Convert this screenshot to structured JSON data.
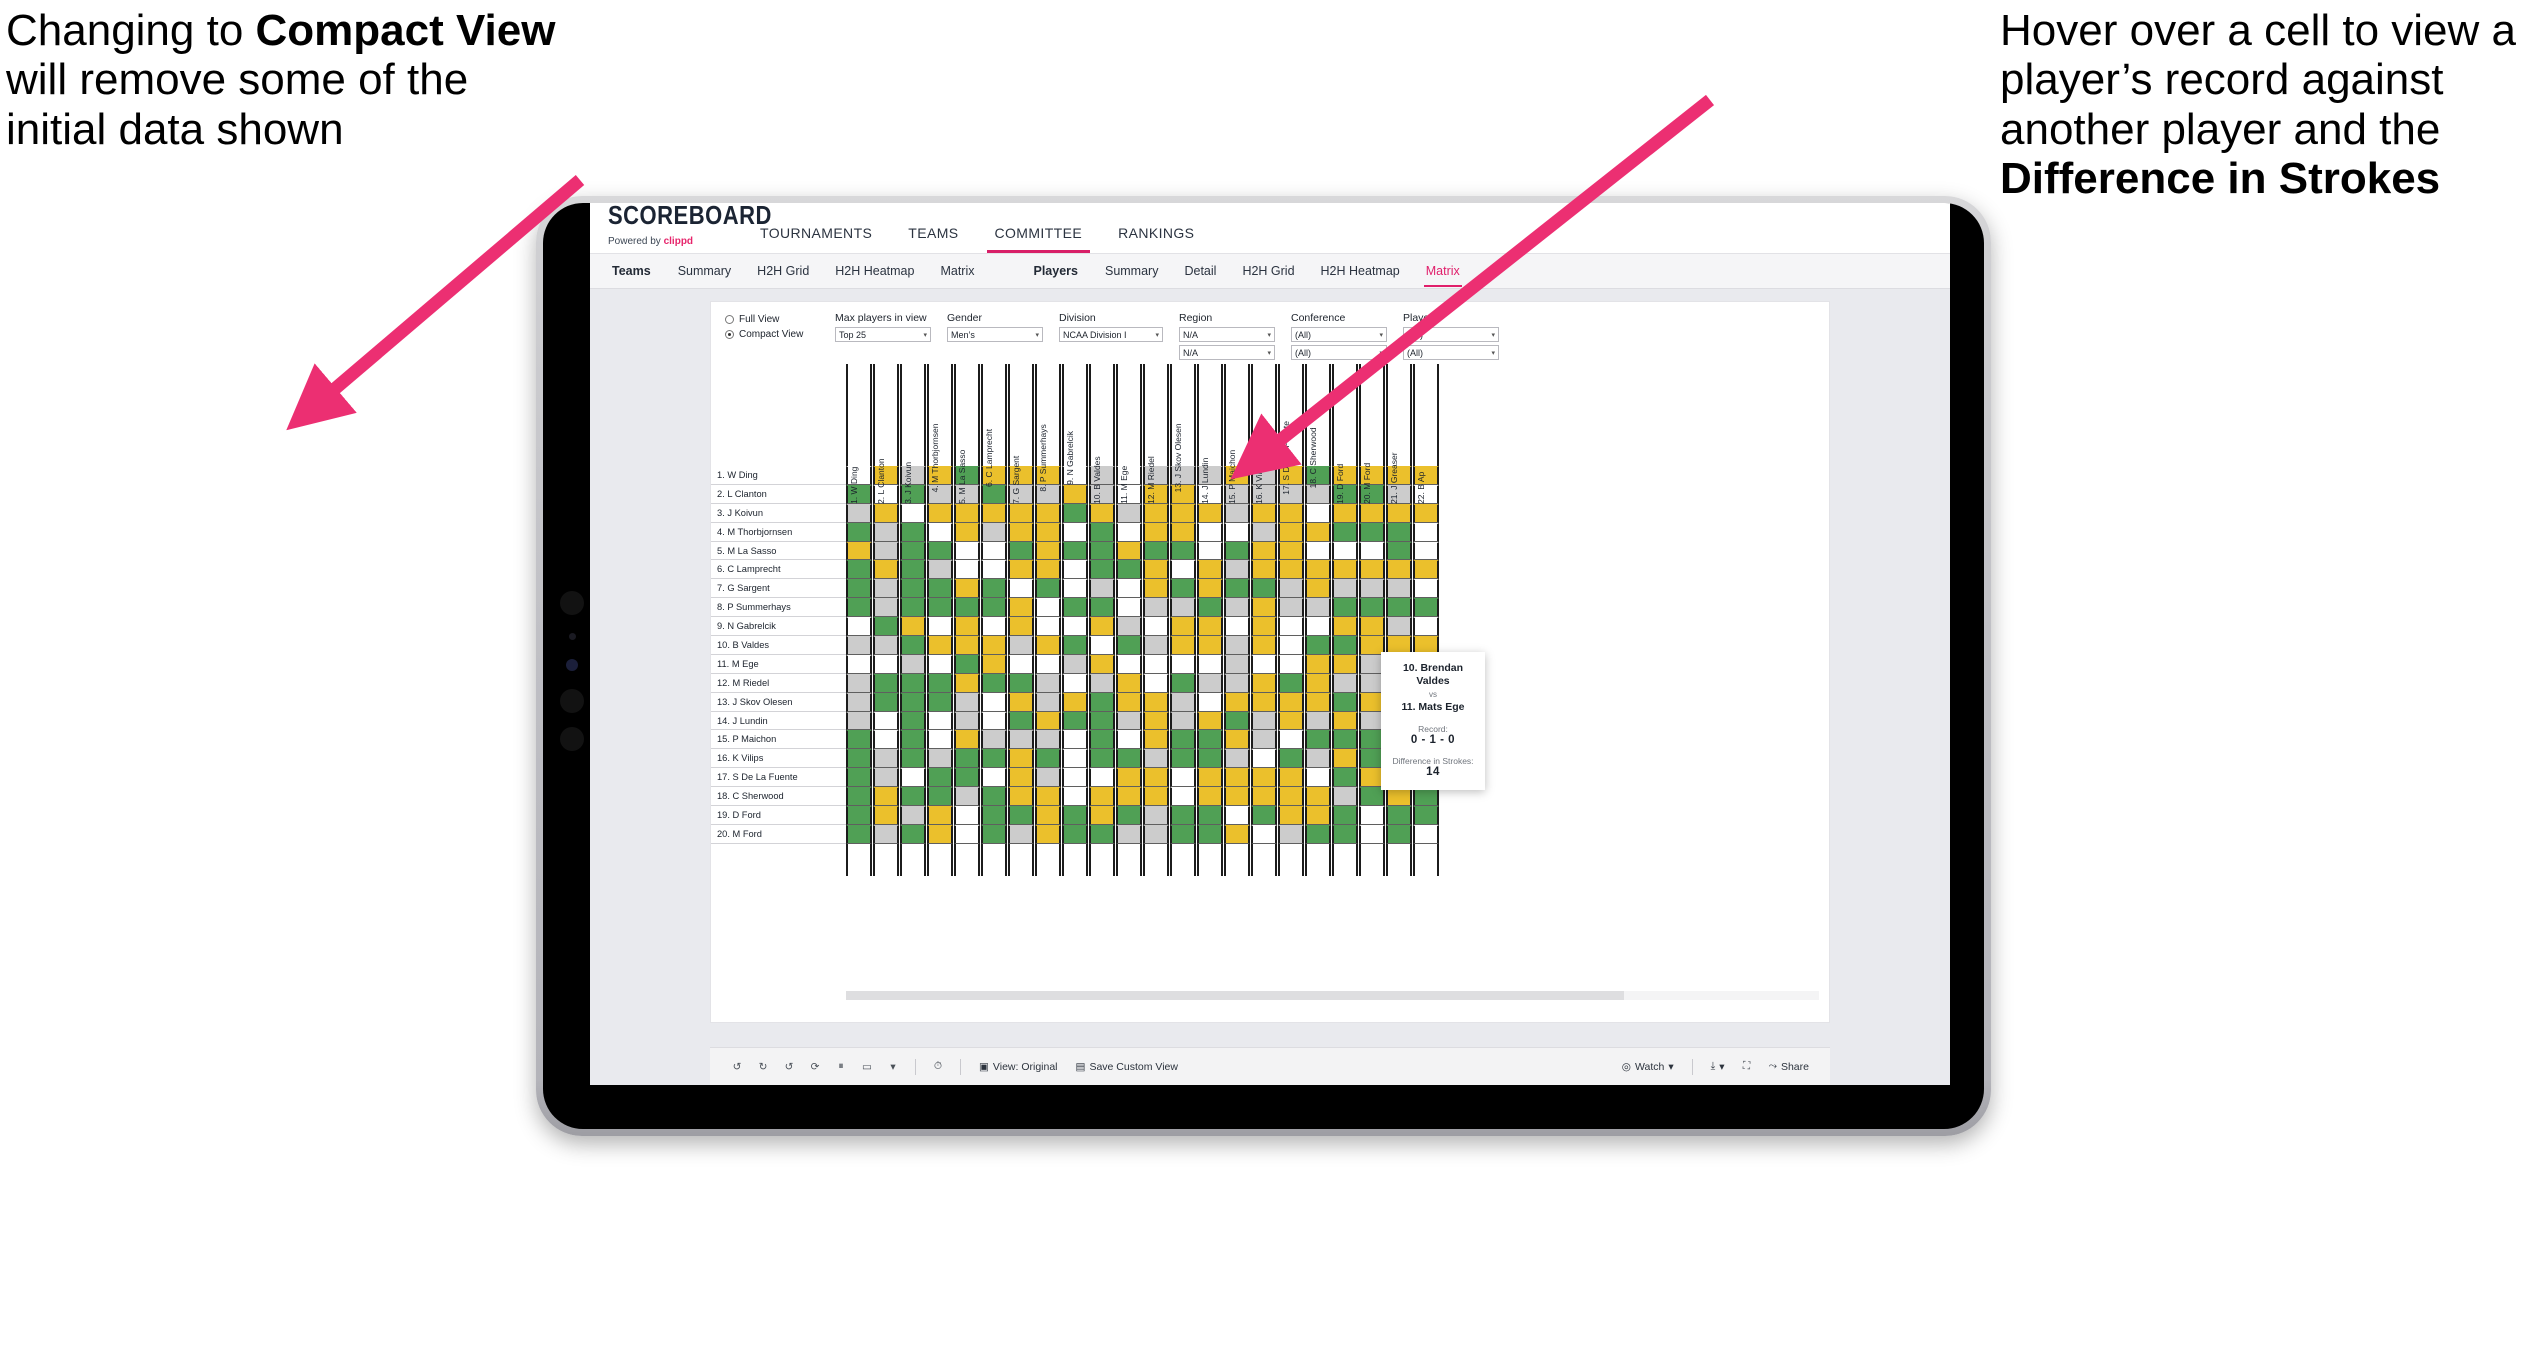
{
  "annotations": {
    "left": {
      "pre": "Changing to ",
      "bold": "Compact View",
      "post": " will remove some of the initial data shown"
    },
    "right": {
      "pre": "Hover over a cell to view a player’s record against another player and the ",
      "bold": "Difference in Strokes",
      "post": ""
    }
  },
  "brand": {
    "name": "SCOREBOARD",
    "powered_pre": "Powered by ",
    "powered_brand": "clippd"
  },
  "topnav": {
    "tabs": [
      "TOURNAMENTS",
      "TEAMS",
      "COMMITTEE",
      "RANKINGS"
    ],
    "active": "COMMITTEE"
  },
  "subnav": {
    "teams_label": "Teams",
    "teams_items": [
      "Summary",
      "H2H Grid",
      "H2H Heatmap",
      "Matrix"
    ],
    "players_label": "Players",
    "players_items": [
      "Summary",
      "Detail",
      "H2H Grid",
      "H2H Heatmap",
      "Matrix"
    ],
    "active": "Matrix"
  },
  "filters": {
    "view_mode": {
      "full_label": "Full View",
      "compact_label": "Compact View",
      "selected": "Compact View"
    },
    "fields": [
      {
        "label": "Max players in view",
        "value": "Top 25",
        "value2": ""
      },
      {
        "label": "Gender",
        "value": "Men’s",
        "value2": ""
      },
      {
        "label": "Division",
        "value": "NCAA Division I",
        "value2": ""
      },
      {
        "label": "Region",
        "value": "N/A",
        "value2": "N/A"
      },
      {
        "label": "Conference",
        "value": "(All)",
        "value2": "(All)"
      },
      {
        "label": "Players",
        "value": "(All)",
        "value2": "(All)"
      }
    ]
  },
  "matrix": {
    "columns": [
      "1. W Ding",
      "2. L Clanton",
      "3. J Koivun",
      "4. M Thorbjornsen",
      "5. M La Sasso",
      "6. C Lamprecht",
      "7. G Sargent",
      "8. P Summerhays",
      "9. N Gabrelcik",
      "10. B Valdes",
      "11. M Ege",
      "12. M Riedel",
      "13. J Skov Olesen",
      "14. J Lundin",
      "15. P Maichon",
      "16. K Vilips",
      "17. S De La Fuente",
      "18. C Sherwood",
      "19. D Ford",
      "20. M Ford",
      "21. J Greaser",
      "22. B Ap"
    ],
    "rows": [
      "1. W Ding",
      "2. L Clanton",
      "3. J Koivun",
      "4. M Thorbjornsen",
      "5. M La Sasso",
      "6. C Lamprecht",
      "7. G Sargent",
      "8. P Summerhays",
      "9. N Gabrelcik",
      "10. B Valdes",
      "11. M Ege",
      "12. M Riedel",
      "13. J Skov Olesen",
      "14. J Lundin",
      "15. P Maichon",
      "16. K Vilips",
      "17. S De La Fuente",
      "18. C Sherwood",
      "19. D Ford",
      "20. M Ford"
    ],
    "legend": {
      "win": "#50a055",
      "tie": "#ebc02c",
      "loss": "#cccccc",
      "none": "#ffffff"
    },
    "cells": [
      [
        "w",
        "y",
        "a",
        "y",
        "g",
        "y",
        "y",
        "y",
        "w",
        "a",
        "w",
        "a",
        "a",
        "a",
        "y",
        "a",
        "y",
        "g",
        "y",
        "y",
        "y",
        "y"
      ],
      [
        "g",
        "w",
        "g",
        "a",
        "a",
        "g",
        "a",
        "a",
        "y",
        "a",
        "w",
        "y",
        "y",
        "w",
        "a",
        "a",
        "a",
        "a",
        "g",
        "g",
        "a",
        "w"
      ],
      [
        "a",
        "y",
        "w",
        "y",
        "y",
        "y",
        "y",
        "y",
        "g",
        "y",
        "a",
        "y",
        "y",
        "y",
        "a",
        "y",
        "y",
        "w",
        "y",
        "y",
        "y",
        "y"
      ],
      [
        "g",
        "a",
        "g",
        "w",
        "y",
        "a",
        "y",
        "y",
        "w",
        "g",
        "w",
        "y",
        "y",
        "w",
        "w",
        "a",
        "y",
        "y",
        "g",
        "g",
        "g",
        "w"
      ],
      [
        "y",
        "a",
        "g",
        "g",
        "w",
        "w",
        "g",
        "y",
        "g",
        "g",
        "y",
        "g",
        "g",
        "w",
        "g",
        "y",
        "y",
        "w",
        "w",
        "w",
        "g",
        "w"
      ],
      [
        "g",
        "y",
        "g",
        "a",
        "w",
        "w",
        "y",
        "y",
        "w",
        "g",
        "g",
        "y",
        "w",
        "y",
        "a",
        "y",
        "y",
        "y",
        "y",
        "y",
        "y",
        "y"
      ],
      [
        "g",
        "a",
        "g",
        "g",
        "y",
        "g",
        "w",
        "g",
        "w",
        "a",
        "w",
        "y",
        "g",
        "y",
        "g",
        "g",
        "a",
        "y",
        "a",
        "a",
        "a",
        "w"
      ],
      [
        "g",
        "a",
        "g",
        "g",
        "g",
        "g",
        "y",
        "w",
        "g",
        "g",
        "w",
        "a",
        "a",
        "g",
        "a",
        "y",
        "a",
        "a",
        "g",
        "g",
        "g",
        "g"
      ],
      [
        "w",
        "g",
        "y",
        "w",
        "y",
        "w",
        "y",
        "w",
        "w",
        "y",
        "a",
        "w",
        "y",
        "y",
        "w",
        "y",
        "w",
        "w",
        "y",
        "y",
        "a",
        "w"
      ],
      [
        "a",
        "a",
        "g",
        "y",
        "y",
        "y",
        "a",
        "y",
        "g",
        "w",
        "g",
        "a",
        "y",
        "y",
        "a",
        "y",
        "w",
        "g",
        "g",
        "y",
        "y",
        "y"
      ],
      [
        "w",
        "w",
        "a",
        "w",
        "g",
        "y",
        "w",
        "w",
        "a",
        "y",
        "w",
        "w",
        "w",
        "w",
        "a",
        "w",
        "w",
        "y",
        "y",
        "a",
        "y",
        "y"
      ],
      [
        "a",
        "g",
        "g",
        "g",
        "y",
        "g",
        "g",
        "a",
        "w",
        "a",
        "y",
        "w",
        "g",
        "a",
        "a",
        "y",
        "g",
        "y",
        "a",
        "a",
        "g",
        "w"
      ],
      [
        "a",
        "g",
        "g",
        "g",
        "a",
        "w",
        "y",
        "a",
        "y",
        "g",
        "y",
        "y",
        "a",
        "w",
        "y",
        "y",
        "y",
        "y",
        "g",
        "y",
        "a",
        "y"
      ],
      [
        "a",
        "w",
        "g",
        "w",
        "a",
        "w",
        "g",
        "y",
        "g",
        "g",
        "a",
        "y",
        "a",
        "y",
        "g",
        "a",
        "y",
        "a",
        "y",
        "a",
        "g",
        "g"
      ],
      [
        "g",
        "w",
        "g",
        "w",
        "y",
        "a",
        "a",
        "a",
        "w",
        "g",
        "w",
        "y",
        "g",
        "g",
        "y",
        "a",
        "w",
        "g",
        "g",
        "g",
        "y",
        "g"
      ],
      [
        "g",
        "a",
        "g",
        "a",
        "g",
        "g",
        "y",
        "g",
        "w",
        "g",
        "g",
        "a",
        "g",
        "g",
        "a",
        "w",
        "g",
        "a",
        "y",
        "g",
        "g",
        "g"
      ],
      [
        "g",
        "a",
        "w",
        "g",
        "g",
        "w",
        "y",
        "a",
        "w",
        "w",
        "y",
        "y",
        "w",
        "y",
        "y",
        "y",
        "y",
        "w",
        "g",
        "y",
        "y",
        "w"
      ],
      [
        "g",
        "y",
        "g",
        "g",
        "a",
        "g",
        "y",
        "y",
        "w",
        "y",
        "y",
        "y",
        "w",
        "y",
        "y",
        "y",
        "y",
        "y",
        "a",
        "g",
        "y",
        "g"
      ],
      [
        "g",
        "y",
        "a",
        "y",
        "w",
        "g",
        "g",
        "y",
        "g",
        "y",
        "g",
        "a",
        "g",
        "g",
        "w",
        "g",
        "y",
        "y",
        "g",
        "w",
        "g",
        "g"
      ],
      [
        "g",
        "a",
        "g",
        "y",
        "w",
        "g",
        "a",
        "y",
        "g",
        "g",
        "a",
        "a",
        "g",
        "g",
        "y",
        "w",
        "a",
        "g",
        "g",
        "w",
        "g",
        "w"
      ]
    ]
  },
  "tooltip": {
    "player_a": "10. Brendan Valdes",
    "vs": "vs",
    "player_b": "11. Mats Ege",
    "record_label": "Record:",
    "record_value": "0 - 1 - 0",
    "diff_label": "Difference in Strokes:",
    "diff_value": "14"
  },
  "bottombar": {
    "view_label": "View: Original",
    "save_label": "Save Custom View",
    "watch_label": "Watch",
    "share_label": "Share"
  }
}
